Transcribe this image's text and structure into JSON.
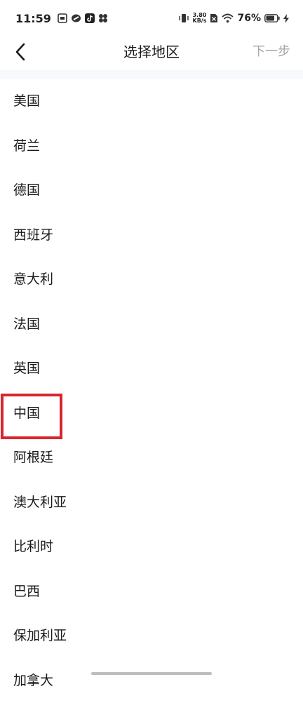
{
  "status_bar": {
    "time": "11:59",
    "speed_value": "3.80",
    "speed_unit": "KB/s",
    "battery": "76%",
    "icons": [
      "notification-icon",
      "link-app-icon",
      "tiktok-icon",
      "app-grid-icon",
      "vibrate-icon",
      "no-sim-icon",
      "wifi-icon",
      "battery-icon",
      "charging-icon"
    ]
  },
  "header": {
    "back_icon": "chevron-left-icon",
    "title": "选择地区",
    "next_label": "下一步"
  },
  "regions": [
    "美国",
    "荷兰",
    "德国",
    "西班牙",
    "意大利",
    "法国",
    "英国",
    "中国",
    "阿根廷",
    "澳大利亚",
    "比利时",
    "巴西",
    "保加利亚",
    "加拿大"
  ],
  "highlighted_region": "中国",
  "colors": {
    "highlight": "#d9252e",
    "next_disabled": "#a6a6a6",
    "divider_band": "#f7f9fd"
  }
}
